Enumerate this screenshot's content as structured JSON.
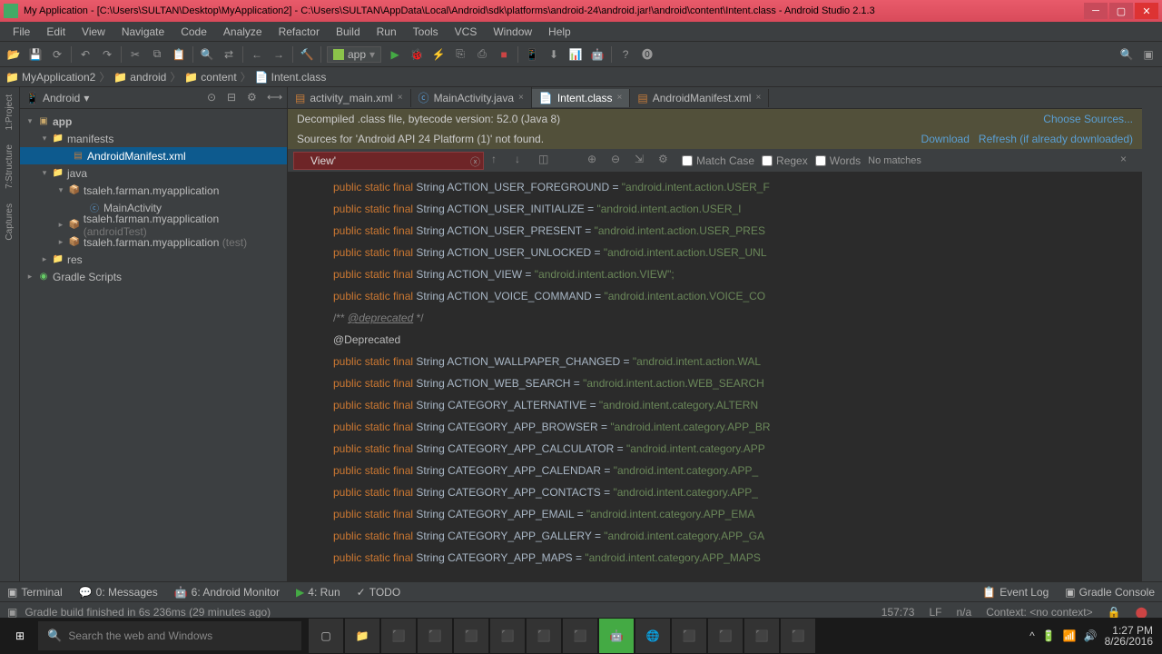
{
  "title": "My Application - [C:\\Users\\SULTAN\\Desktop\\MyApplication2] - C:\\Users\\SULTAN\\AppData\\Local\\Android\\sdk\\platforms\\android-24\\android.jar!\\android\\content\\Intent.class - Android Studio 2.1.3",
  "menu": [
    "File",
    "Edit",
    "View",
    "Navigate",
    "Code",
    "Analyze",
    "Refactor",
    "Build",
    "Run",
    "Tools",
    "VCS",
    "Window",
    "Help"
  ],
  "run_config": "app",
  "breadcrumb": [
    "MyApplication2",
    "android",
    "content",
    "Intent.class"
  ],
  "panel_mode": "Android",
  "tree": {
    "app": "app",
    "manifests": "manifests",
    "manifest_file": "AndroidManifest.xml",
    "java": "java",
    "pkg": "tsaleh.farman.myapplication",
    "activity": "MainActivity",
    "pkg_at": "tsaleh.farman.myapplication",
    "at": "(androidTest)",
    "pkg_t": "tsaleh.farman.myapplication",
    "t": "(test)",
    "res": "res",
    "gradle": "Gradle Scripts"
  },
  "tabs": [
    {
      "label": "activity_main.xml"
    },
    {
      "label": "MainActivity.java"
    },
    {
      "label": "Intent.class",
      "active": true
    },
    {
      "label": "AndroidManifest.xml"
    }
  ],
  "banner1": "Decompiled .class file, bytecode version: 52.0 (Java 8)",
  "banner1_link": "Choose Sources...",
  "banner2": "Sources for 'Android API 24 Platform (1)' not found.",
  "banner2_link1": "Download",
  "banner2_link2": "Refresh (if already downloaded)",
  "find": {
    "value": "View'",
    "match_case": "Match Case",
    "regex": "Regex",
    "words": "Words",
    "result": "No matches"
  },
  "code": [
    {
      "m": "public static final",
      "t": "String",
      "n": "ACTION_USER_FOREGROUND",
      "v": "\"android.intent.action.USER_F"
    },
    {
      "m": "public static final",
      "t": "String",
      "n": "ACTION_USER_INITIALIZE",
      "v": "\"android.intent.action.USER_I"
    },
    {
      "m": "public static final",
      "t": "String",
      "n": "ACTION_USER_PRESENT",
      "v": "\"android.intent.action.USER_PRES"
    },
    {
      "m": "public static final",
      "t": "String",
      "n": "ACTION_USER_UNLOCKED",
      "v": "\"android.intent.action.USER_UNL"
    },
    {
      "m": "public static final",
      "t": "String",
      "n": "ACTION_VIEW",
      "v": "\"android.intent.action.VIEW\";"
    },
    {
      "m": "public static final",
      "t": "String",
      "n": "ACTION_VOICE_COMMAND",
      "v": "\"android.intent.action.VOICE_CO"
    },
    {
      "comment": "/** @deprecated */"
    },
    {
      "ann": "@Deprecated"
    },
    {
      "m": "public static final",
      "t": "String",
      "n": "ACTION_WALLPAPER_CHANGED",
      "v": "\"android.intent.action.WAL"
    },
    {
      "m": "public static final",
      "t": "String",
      "n": "ACTION_WEB_SEARCH",
      "v": "\"android.intent.action.WEB_SEARCH"
    },
    {
      "m": "public static final",
      "t": "String",
      "n": "CATEGORY_ALTERNATIVE",
      "v": "\"android.intent.category.ALTERN"
    },
    {
      "m": "public static final",
      "t": "String",
      "n": "CATEGORY_APP_BROWSER",
      "v": "\"android.intent.category.APP_BR"
    },
    {
      "m": "public static final",
      "t": "String",
      "n": "CATEGORY_APP_CALCULATOR",
      "v": "\"android.intent.category.APP"
    },
    {
      "m": "public static final",
      "t": "String",
      "n": "CATEGORY_APP_CALENDAR",
      "v": "\"android.intent.category.APP_"
    },
    {
      "m": "public static final",
      "t": "String",
      "n": "CATEGORY_APP_CONTACTS",
      "v": "\"android.intent.category.APP_"
    },
    {
      "m": "public static final",
      "t": "String",
      "n": "CATEGORY_APP_EMAIL",
      "v": "\"android.intent.category.APP_EMA"
    },
    {
      "m": "public static final",
      "t": "String",
      "n": "CATEGORY_APP_GALLERY",
      "v": "\"android.intent.category.APP_GA"
    },
    {
      "m": "public static final",
      "t": "String",
      "n": "CATEGORY_APP_MAPS",
      "v": "\"android.intent.category.APP_MAPS"
    }
  ],
  "bottom_tabs": {
    "terminal": "Terminal",
    "messages": "0: Messages",
    "monitor": "6: Android Monitor",
    "run": "4: Run",
    "todo": "TODO",
    "event": "Event Log",
    "gradle": "Gradle Console"
  },
  "status": {
    "msg": "Gradle build finished in 6s 236ms (29 minutes ago)",
    "pos": "157:73",
    "lf": "LF",
    "enc": "n/a",
    "ctx": "Context: <no context>"
  },
  "search_ph": "Search the web and Windows",
  "clock": {
    "time": "1:27 PM",
    "date": "8/26/2016"
  }
}
